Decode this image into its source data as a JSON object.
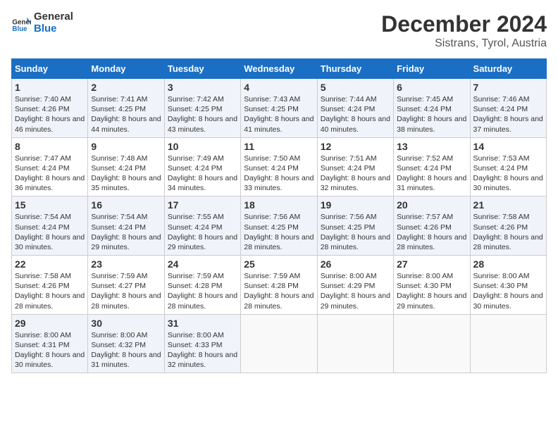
{
  "logo": {
    "line1": "General",
    "line2": "Blue"
  },
  "title": "December 2024",
  "subtitle": "Sistrans, Tyrol, Austria",
  "weekdays": [
    "Sunday",
    "Monday",
    "Tuesday",
    "Wednesday",
    "Thursday",
    "Friday",
    "Saturday"
  ],
  "weeks": [
    [
      {
        "day": "1",
        "sunrise": "Sunrise: 7:40 AM",
        "sunset": "Sunset: 4:26 PM",
        "daylight": "Daylight: 8 hours and 46 minutes."
      },
      {
        "day": "2",
        "sunrise": "Sunrise: 7:41 AM",
        "sunset": "Sunset: 4:25 PM",
        "daylight": "Daylight: 8 hours and 44 minutes."
      },
      {
        "day": "3",
        "sunrise": "Sunrise: 7:42 AM",
        "sunset": "Sunset: 4:25 PM",
        "daylight": "Daylight: 8 hours and 43 minutes."
      },
      {
        "day": "4",
        "sunrise": "Sunrise: 7:43 AM",
        "sunset": "Sunset: 4:25 PM",
        "daylight": "Daylight: 8 hours and 41 minutes."
      },
      {
        "day": "5",
        "sunrise": "Sunrise: 7:44 AM",
        "sunset": "Sunset: 4:24 PM",
        "daylight": "Daylight: 8 hours and 40 minutes."
      },
      {
        "day": "6",
        "sunrise": "Sunrise: 7:45 AM",
        "sunset": "Sunset: 4:24 PM",
        "daylight": "Daylight: 8 hours and 38 minutes."
      },
      {
        "day": "7",
        "sunrise": "Sunrise: 7:46 AM",
        "sunset": "Sunset: 4:24 PM",
        "daylight": "Daylight: 8 hours and 37 minutes."
      }
    ],
    [
      {
        "day": "8",
        "sunrise": "Sunrise: 7:47 AM",
        "sunset": "Sunset: 4:24 PM",
        "daylight": "Daylight: 8 hours and 36 minutes."
      },
      {
        "day": "9",
        "sunrise": "Sunrise: 7:48 AM",
        "sunset": "Sunset: 4:24 PM",
        "daylight": "Daylight: 8 hours and 35 minutes."
      },
      {
        "day": "10",
        "sunrise": "Sunrise: 7:49 AM",
        "sunset": "Sunset: 4:24 PM",
        "daylight": "Daylight: 8 hours and 34 minutes."
      },
      {
        "day": "11",
        "sunrise": "Sunrise: 7:50 AM",
        "sunset": "Sunset: 4:24 PM",
        "daylight": "Daylight: 8 hours and 33 minutes."
      },
      {
        "day": "12",
        "sunrise": "Sunrise: 7:51 AM",
        "sunset": "Sunset: 4:24 PM",
        "daylight": "Daylight: 8 hours and 32 minutes."
      },
      {
        "day": "13",
        "sunrise": "Sunrise: 7:52 AM",
        "sunset": "Sunset: 4:24 PM",
        "daylight": "Daylight: 8 hours and 31 minutes."
      },
      {
        "day": "14",
        "sunrise": "Sunrise: 7:53 AM",
        "sunset": "Sunset: 4:24 PM",
        "daylight": "Daylight: 8 hours and 30 minutes."
      }
    ],
    [
      {
        "day": "15",
        "sunrise": "Sunrise: 7:54 AM",
        "sunset": "Sunset: 4:24 PM",
        "daylight": "Daylight: 8 hours and 30 minutes."
      },
      {
        "day": "16",
        "sunrise": "Sunrise: 7:54 AM",
        "sunset": "Sunset: 4:24 PM",
        "daylight": "Daylight: 8 hours and 29 minutes."
      },
      {
        "day": "17",
        "sunrise": "Sunrise: 7:55 AM",
        "sunset": "Sunset: 4:24 PM",
        "daylight": "Daylight: 8 hours and 29 minutes."
      },
      {
        "day": "18",
        "sunrise": "Sunrise: 7:56 AM",
        "sunset": "Sunset: 4:25 PM",
        "daylight": "Daylight: 8 hours and 28 minutes."
      },
      {
        "day": "19",
        "sunrise": "Sunrise: 7:56 AM",
        "sunset": "Sunset: 4:25 PM",
        "daylight": "Daylight: 8 hours and 28 minutes."
      },
      {
        "day": "20",
        "sunrise": "Sunrise: 7:57 AM",
        "sunset": "Sunset: 4:26 PM",
        "daylight": "Daylight: 8 hours and 28 minutes."
      },
      {
        "day": "21",
        "sunrise": "Sunrise: 7:58 AM",
        "sunset": "Sunset: 4:26 PM",
        "daylight": "Daylight: 8 hours and 28 minutes."
      }
    ],
    [
      {
        "day": "22",
        "sunrise": "Sunrise: 7:58 AM",
        "sunset": "Sunset: 4:26 PM",
        "daylight": "Daylight: 8 hours and 28 minutes."
      },
      {
        "day": "23",
        "sunrise": "Sunrise: 7:59 AM",
        "sunset": "Sunset: 4:27 PM",
        "daylight": "Daylight: 8 hours and 28 minutes."
      },
      {
        "day": "24",
        "sunrise": "Sunrise: 7:59 AM",
        "sunset": "Sunset: 4:28 PM",
        "daylight": "Daylight: 8 hours and 28 minutes."
      },
      {
        "day": "25",
        "sunrise": "Sunrise: 7:59 AM",
        "sunset": "Sunset: 4:28 PM",
        "daylight": "Daylight: 8 hours and 28 minutes."
      },
      {
        "day": "26",
        "sunrise": "Sunrise: 8:00 AM",
        "sunset": "Sunset: 4:29 PM",
        "daylight": "Daylight: 8 hours and 29 minutes."
      },
      {
        "day": "27",
        "sunrise": "Sunrise: 8:00 AM",
        "sunset": "Sunset: 4:30 PM",
        "daylight": "Daylight: 8 hours and 29 minutes."
      },
      {
        "day": "28",
        "sunrise": "Sunrise: 8:00 AM",
        "sunset": "Sunset: 4:30 PM",
        "daylight": "Daylight: 8 hours and 30 minutes."
      }
    ],
    [
      {
        "day": "29",
        "sunrise": "Sunrise: 8:00 AM",
        "sunset": "Sunset: 4:31 PM",
        "daylight": "Daylight: 8 hours and 30 minutes."
      },
      {
        "day": "30",
        "sunrise": "Sunrise: 8:00 AM",
        "sunset": "Sunset: 4:32 PM",
        "daylight": "Daylight: 8 hours and 31 minutes."
      },
      {
        "day": "31",
        "sunrise": "Sunrise: 8:00 AM",
        "sunset": "Sunset: 4:33 PM",
        "daylight": "Daylight: 8 hours and 32 minutes."
      },
      null,
      null,
      null,
      null
    ]
  ]
}
